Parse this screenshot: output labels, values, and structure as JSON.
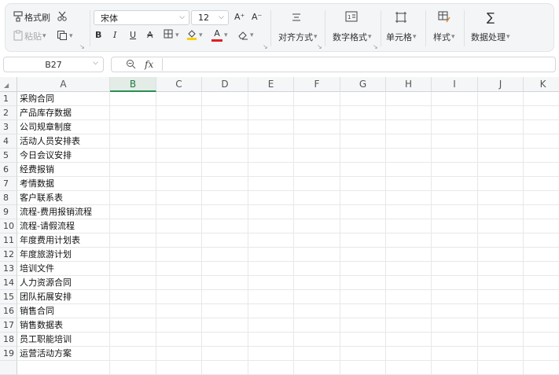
{
  "ribbon": {
    "format_painter": "格式刷",
    "paste": "粘贴",
    "font_name": "宋体",
    "font_size": "12",
    "align_label": "对齐方式",
    "number_format_label": "数字格式",
    "cell_label": "单元格",
    "style_label": "样式",
    "data_process_label": "数据处理",
    "bold": "B",
    "italic": "I",
    "underline": "U",
    "strike": "A",
    "font_color_letter": "A",
    "grow_font": "A⁺",
    "shrink_font": "A⁻"
  },
  "formula_bar": {
    "name_box": "B27",
    "fx": "fx",
    "content": ""
  },
  "sheet": {
    "columns": [
      "A",
      "B",
      "C",
      "D",
      "E",
      "F",
      "G",
      "H",
      "I",
      "J",
      "K"
    ],
    "active_column": "B",
    "rows": [
      {
        "num": "1",
        "a": "采购合同"
      },
      {
        "num": "2",
        "a": "产品库存数据"
      },
      {
        "num": "3",
        "a": "公司规章制度"
      },
      {
        "num": "4",
        "a": "活动人员安排表"
      },
      {
        "num": "5",
        "a": "今日会议安排"
      },
      {
        "num": "6",
        "a": "经费报销"
      },
      {
        "num": "7",
        "a": "考情数据"
      },
      {
        "num": "8",
        "a": "客户联系表"
      },
      {
        "num": "9",
        "a": "流程-费用报销流程"
      },
      {
        "num": "10",
        "a": "流程-请假流程"
      },
      {
        "num": "11",
        "a": "年度费用计划表"
      },
      {
        "num": "12",
        "a": "年度旅游计划"
      },
      {
        "num": "13",
        "a": "培训文件"
      },
      {
        "num": "14",
        "a": "人力资源合同"
      },
      {
        "num": "15",
        "a": "团队拓展安排"
      },
      {
        "num": "16",
        "a": "销售合同"
      },
      {
        "num": "17",
        "a": "销售数据表"
      },
      {
        "num": "18",
        "a": "员工职能培训"
      },
      {
        "num": "19",
        "a": "运营活动方案"
      }
    ]
  },
  "colors": {
    "accent": "#2a8f53",
    "font_color": "#e02020",
    "fill_color": "#f5d100"
  }
}
